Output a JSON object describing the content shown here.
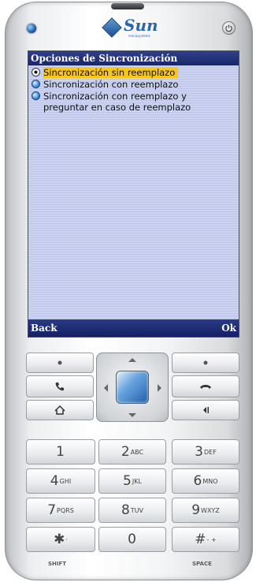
{
  "device": {
    "brand": "Sun",
    "brand_sub": "microsystems"
  },
  "screen": {
    "title": "Opciones de Sincronización",
    "options": [
      {
        "label": "Sincronización sin reemplazo",
        "selected": true,
        "highlighted": true
      },
      {
        "label": "Sincronización con reemplazo",
        "selected": false,
        "highlighted": false
      },
      {
        "label": "Sincronización con reemplazo y preguntar en caso de reemplazo",
        "selected": false,
        "highlighted": false
      }
    ],
    "soft_left": "Back",
    "soft_right": "Ok"
  },
  "keypad": {
    "keys": [
      {
        "digit": "1",
        "letters": ""
      },
      {
        "digit": "2",
        "letters": "ABC"
      },
      {
        "digit": "3",
        "letters": "DEF"
      },
      {
        "digit": "4",
        "letters": "GHI"
      },
      {
        "digit": "5",
        "letters": "JKL"
      },
      {
        "digit": "6",
        "letters": "MNO"
      },
      {
        "digit": "7",
        "letters": "PQRS"
      },
      {
        "digit": "8",
        "letters": "TUV"
      },
      {
        "digit": "9",
        "letters": "WXYZ"
      },
      {
        "digit": "✱",
        "letters": "·"
      },
      {
        "digit": "0",
        "letters": ""
      },
      {
        "digit": "#",
        "letters": "- +"
      }
    ],
    "shift_label": "SHIFT",
    "space_label": "SPACE"
  },
  "colors": {
    "title_bar": "#1a2767",
    "highlight": "#f7c51b",
    "content_bg": "#c9d0ef"
  }
}
